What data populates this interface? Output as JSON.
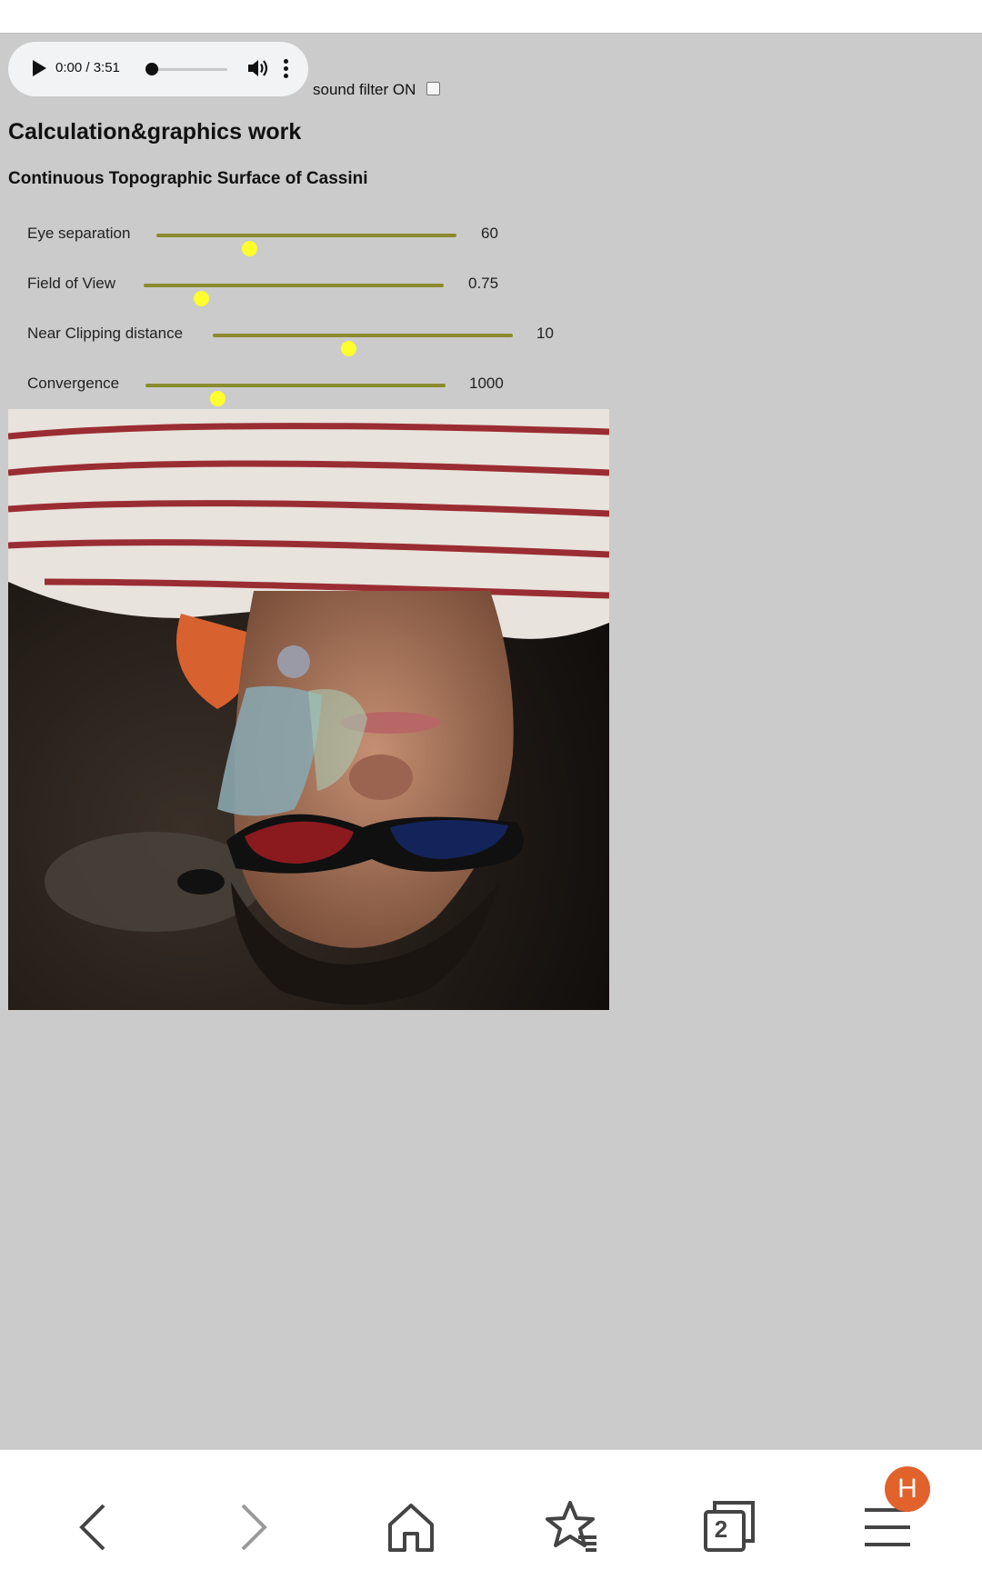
{
  "audio_player": {
    "time": "0:00 / 3:51",
    "progress_fraction": 0.0
  },
  "sound_filter": {
    "label": "sound filter ON",
    "checked": false
  },
  "page": {
    "title": "Calculation&graphics work",
    "subtitle": "Continuous Topographic Surface of Cassini"
  },
  "controls": [
    {
      "label": "Eye separation",
      "value": "60",
      "fraction": 0.31
    },
    {
      "label": "Field of View",
      "value": "0.75",
      "fraction": 0.19
    },
    {
      "label": "Near Clipping distance",
      "value": "10",
      "fraction": 0.45
    },
    {
      "label": "Convergence",
      "value": "1000",
      "fraction": 0.24
    }
  ],
  "browser_nav": {
    "tabs_count": "2",
    "profile_initial": "H"
  },
  "colors": {
    "page_background": "#cbcbcb",
    "slider_track": "#8a8a2e",
    "slider_thumb": "#ffff2e",
    "profile_badge": "#e2622b"
  },
  "icons": [
    "play-icon",
    "volume-icon",
    "more-vert-icon",
    "back-icon",
    "forward-icon",
    "home-icon",
    "bookmarks-icon",
    "tabs-icon",
    "menu-icon"
  ]
}
